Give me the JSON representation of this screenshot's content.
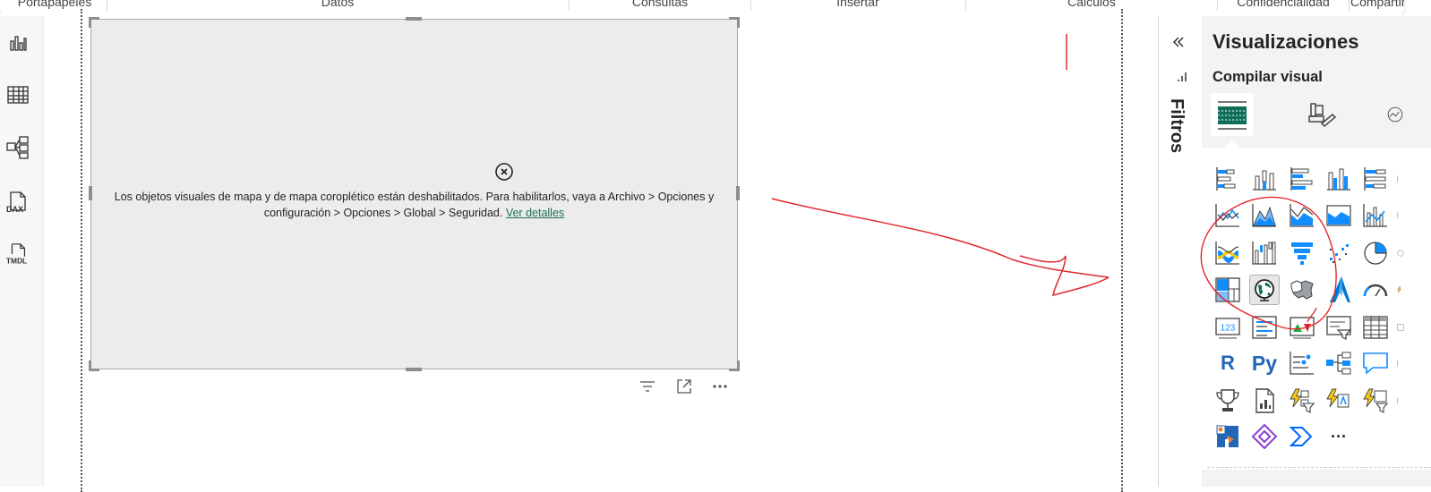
{
  "ribbon": {
    "groups": [
      "Portapapeles",
      "Datos",
      "Consultas",
      "Insertar",
      "Cálculos",
      "Confidencialidad",
      "Compartir"
    ]
  },
  "left_rail": {
    "items": [
      {
        "name": "report-view-icon",
        "label": ""
      },
      {
        "name": "table-view-icon",
        "label": ""
      },
      {
        "name": "model-view-icon",
        "label": ""
      },
      {
        "name": "dax-query-view-icon",
        "label": "DAX"
      },
      {
        "name": "tmdl-view-icon",
        "label": "TMDL"
      }
    ]
  },
  "visual": {
    "error_message": "Los objetos visuales de mapa y de mapa coroplético están deshabilitados. Para habilitarlos, vaya a Archivo > Opciones y configuración > Opciones > Global > Seguridad.",
    "link_text": "Ver detalles",
    "toolbar": [
      "filter-icon",
      "focus-mode-icon",
      "more-options-icon"
    ]
  },
  "filters_pane": {
    "label": "Filtros",
    "collapse_icon": "double-chevron-left-icon"
  },
  "viz_pane": {
    "title": "Visualizaciones",
    "subtitle": "Compilar visual",
    "tabs": [
      "build-visual-icon",
      "format-visual-icon",
      "analytics-icon"
    ],
    "r_label": "R",
    "py_label": "Py",
    "more_label": "···",
    "kpi_label": "123"
  },
  "colors": {
    "accent_green": "#1d7152",
    "viz_blue": "#118dff",
    "annotation_red": "#e0282e",
    "viz_teal": "#0d6e5a"
  }
}
